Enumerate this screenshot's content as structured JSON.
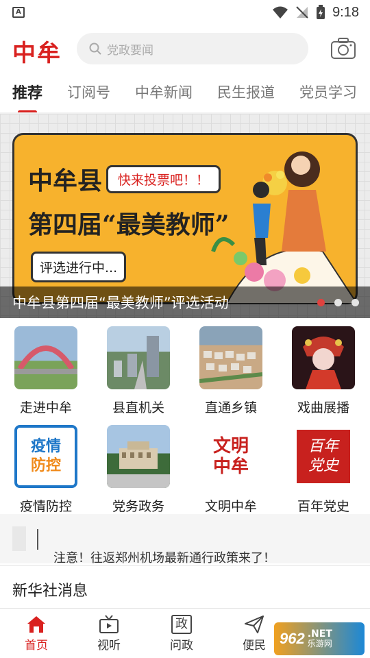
{
  "status_bar": {
    "time": "9:18",
    "left_badge": "A"
  },
  "header": {
    "logo": "中牟",
    "search_placeholder": "党政要闻",
    "camera_icon": "camera-icon"
  },
  "tabs": [
    {
      "label": "推荐",
      "active": true
    },
    {
      "label": "订阅号",
      "active": false
    },
    {
      "label": "中牟新闻",
      "active": false
    },
    {
      "label": "民生报道",
      "active": false
    },
    {
      "label": "党员学习",
      "active": false
    }
  ],
  "banner": {
    "poster_line1": "中牟县",
    "poster_line2": "第四届“最美教师”",
    "poster_bubble": "快来投票吧！！",
    "poster_progress": "评选进行中...",
    "caption": "中牟县第四届“最美教师”评选活动",
    "dots_total": 3,
    "dots_active_index": 0
  },
  "grid": [
    {
      "label": "走进中牟",
      "thumb_color": "#9bbad8",
      "thumb_alt": "#7aa35a"
    },
    {
      "label": "县直机关",
      "thumb_color": "#b9cfe2",
      "thumb_alt": "#6c8a66"
    },
    {
      "label": "直通乡镇",
      "thumb_color": "#8aa3b8",
      "thumb_alt": "#c9a985"
    },
    {
      "label": "戏曲展播",
      "thumb_color": "#2a1418",
      "thumb_alt": "#c43a2c"
    },
    {
      "label": "疫情防控",
      "thumb_color": "#1e77c8",
      "thumb_alt": "#ffffff",
      "text": "疫情\n防控"
    },
    {
      "label": "党务政务",
      "thumb_color": "#a7c5e2",
      "thumb_alt": "#3d6b3a"
    },
    {
      "label": "文明中牟",
      "thumb_color": "#ffffff",
      "thumb_alt": "#c8211e",
      "text": "文明\n中牟"
    },
    {
      "label": "百年党史",
      "thumb_color": "#ffffff",
      "thumb_alt": "#c8211e",
      "text": "百年\n党史"
    }
  ],
  "ticker": {
    "text": "注意！往返郑州机场最新通行政策来了！"
  },
  "section": {
    "title": "新华社消息"
  },
  "bottom_nav": [
    {
      "label": "首页",
      "icon": "home-icon",
      "active": true
    },
    {
      "label": "视听",
      "icon": "tv-icon",
      "active": false
    },
    {
      "label": "问政",
      "icon": "politics-icon",
      "glyph": "政",
      "active": false
    },
    {
      "label": "便民",
      "icon": "send-icon",
      "active": false
    },
    {
      "label": "",
      "icon": "profile-icon",
      "active": false
    }
  ],
  "watermark": {
    "number": "962",
    "suffix": ".NET",
    "sub": "乐游网"
  },
  "colors": {
    "brand_red": "#d9211f",
    "poster_yellow": "#f7b22d"
  }
}
